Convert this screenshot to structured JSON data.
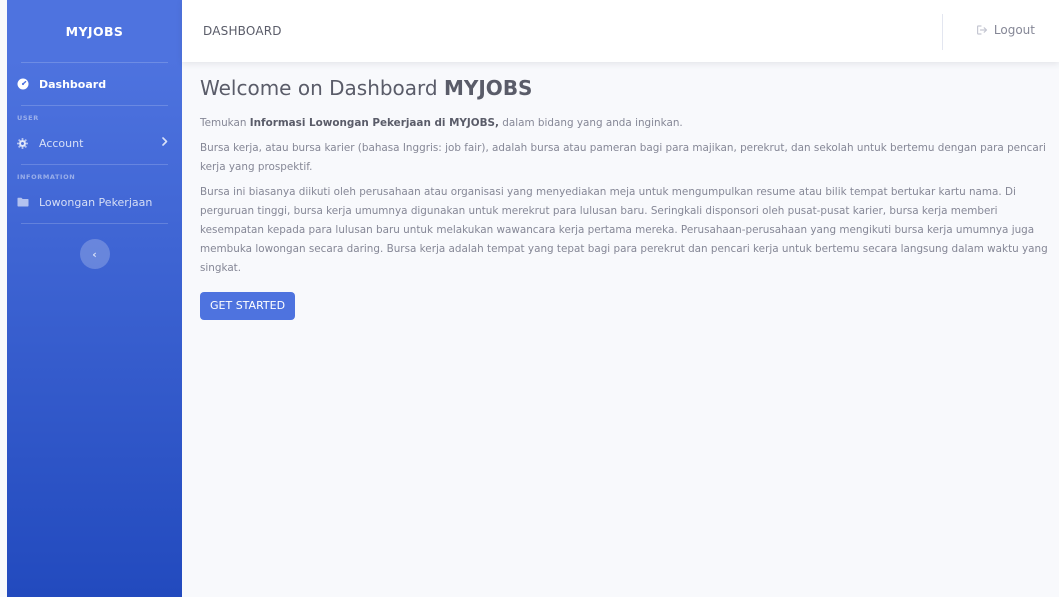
{
  "sidebar": {
    "brand": "MYJOBS",
    "dashboard_label": "Dashboard",
    "section_user": "USER",
    "account_label": "Account",
    "section_information": "INFORMATION",
    "lowongan_label": "Lowongan Pekerjaan",
    "toggle_glyph": "‹"
  },
  "topbar": {
    "title": "DASHBOARD",
    "logout_label": "Logout"
  },
  "main": {
    "welcome_prefix": "Welcome on Dashboard ",
    "welcome_brand": "MYJOBS",
    "p1_prefix": "Temukan ",
    "p1_bold": "Informasi Lowongan Pekerjaan di MYJOBS,",
    "p1_suffix": " dalam bidang yang anda inginkan.",
    "p2": "Bursa kerja, atau bursa karier (bahasa Inggris: job fair), adalah bursa atau pameran bagi para majikan, perekrut, dan sekolah untuk bertemu dengan para pencari kerja yang prospektif.",
    "p3": "Bursa ini biasanya diikuti oleh perusahaan atau organisasi yang menyediakan meja untuk mengumpulkan resume atau bilik tempat bertukar kartu nama. Di perguruan tinggi, bursa kerja umumnya digunakan untuk merekrut para lulusan baru. Seringkali disponsori oleh pusat-pusat karier, bursa kerja memberi kesempatan kepada para lulusan baru untuk melakukan wawancara kerja pertama mereka. Perusahaan-perusahaan yang mengikuti bursa kerja umumnya juga membuka lowongan secara daring. Bursa kerja adalah tempat yang tepat bagi para perekrut dan pencari kerja untuk bertemu secara langsung dalam waktu yang singkat.",
    "cta_label": "GET STARTED"
  },
  "icons": {
    "dashboard": "dashboard-gauge-icon",
    "account": "gear-icon",
    "account_chevron": "chevron-right-icon",
    "lowongan": "folder-icon",
    "toggle": "chevron-left-icon",
    "logout": "sign-out-icon"
  },
  "colors": {
    "primary": "#4e73df",
    "primary_dark": "#224abe",
    "text_heading": "#5a5c69",
    "text_body": "#858796",
    "background": "#f8f9fc"
  }
}
